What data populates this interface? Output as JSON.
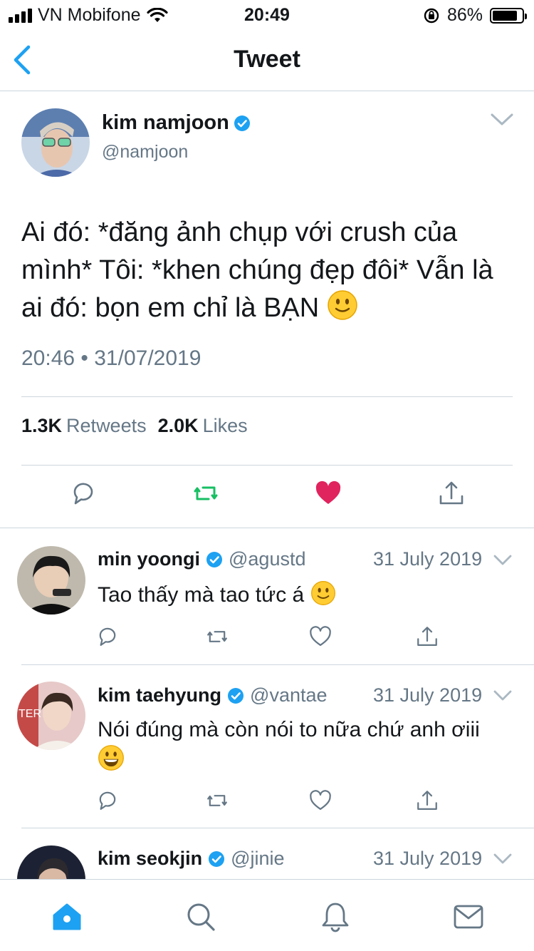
{
  "status": {
    "carrier": "VN Mobifone",
    "time": "20:49",
    "battery": "86%",
    "battery_level": 0.86
  },
  "nav": {
    "title": "Tweet"
  },
  "tweet": {
    "name": "kim namjoon",
    "handle": "@namjoon",
    "text": "Ai đó: *đăng ảnh chụp với crush của mình*  Tôi: *khen chúng đẹp đôi* Vẫn là ai đó: bọn em chỉ là BẠN",
    "time": "20:46 • 31/07/2019",
    "retweets_count": "1.3K",
    "retweets_label": "Retweets",
    "likes_count": "2.0K",
    "likes_label": "Likes"
  },
  "replies": [
    {
      "name": "min yoongi",
      "handle": "@agustd",
      "date": "31 July 2019",
      "text": "Tao thấy mà tao tức á"
    },
    {
      "name": "kim taehyung",
      "handle": "@vantae",
      "date": "31 July 2019",
      "text": "Nói đúng mà còn nói to nữa chứ anh ơiii"
    },
    {
      "name": "kim seokjin",
      "handle": "@jinie",
      "date": "31 July 2019",
      "text": ""
    }
  ],
  "colors": {
    "accent": "#1da1f2",
    "retweet_green": "#17bf63",
    "like_red": "#e0245e",
    "secondary_text": "#657786",
    "divider": "#ccd6dd"
  },
  "icons": [
    "back-chevron-icon",
    "verified-badge-icon",
    "caret-down-icon",
    "reply-icon",
    "retweet-icon",
    "heart-icon",
    "share-icon",
    "home-icon",
    "search-icon",
    "bell-icon",
    "mail-icon"
  ]
}
